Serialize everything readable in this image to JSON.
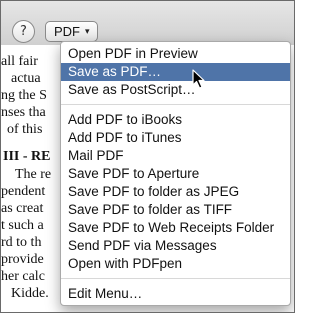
{
  "toolbar": {
    "help_label": "?",
    "pdf_label": "PDF",
    "pdf_caret": "▾"
  },
  "document": {
    "fragments": [
      "all fair",
      "actua",
      "ng the S",
      "nses tha",
      "of this",
      "III - RE",
      "The re",
      "pendent",
      "as creat",
      "t such a",
      "rd to th",
      "provide",
      "her calc",
      "Kidde."
    ]
  },
  "menu": {
    "group1": [
      "Open PDF in Preview",
      "Save as PDF…",
      "Save as PostScript…"
    ],
    "group2": [
      "Add PDF to iBooks",
      "Add PDF to iTunes",
      "Mail PDF",
      "Save PDF to Aperture",
      "Save PDF to folder as JPEG",
      "Save PDF to folder as TIFF",
      "Save PDF to Web Receipts Folder",
      "Send PDF via Messages",
      "Open with PDFpen"
    ],
    "group3": [
      "Edit Menu…"
    ]
  },
  "colors": {
    "highlight": "#4f74a8"
  }
}
